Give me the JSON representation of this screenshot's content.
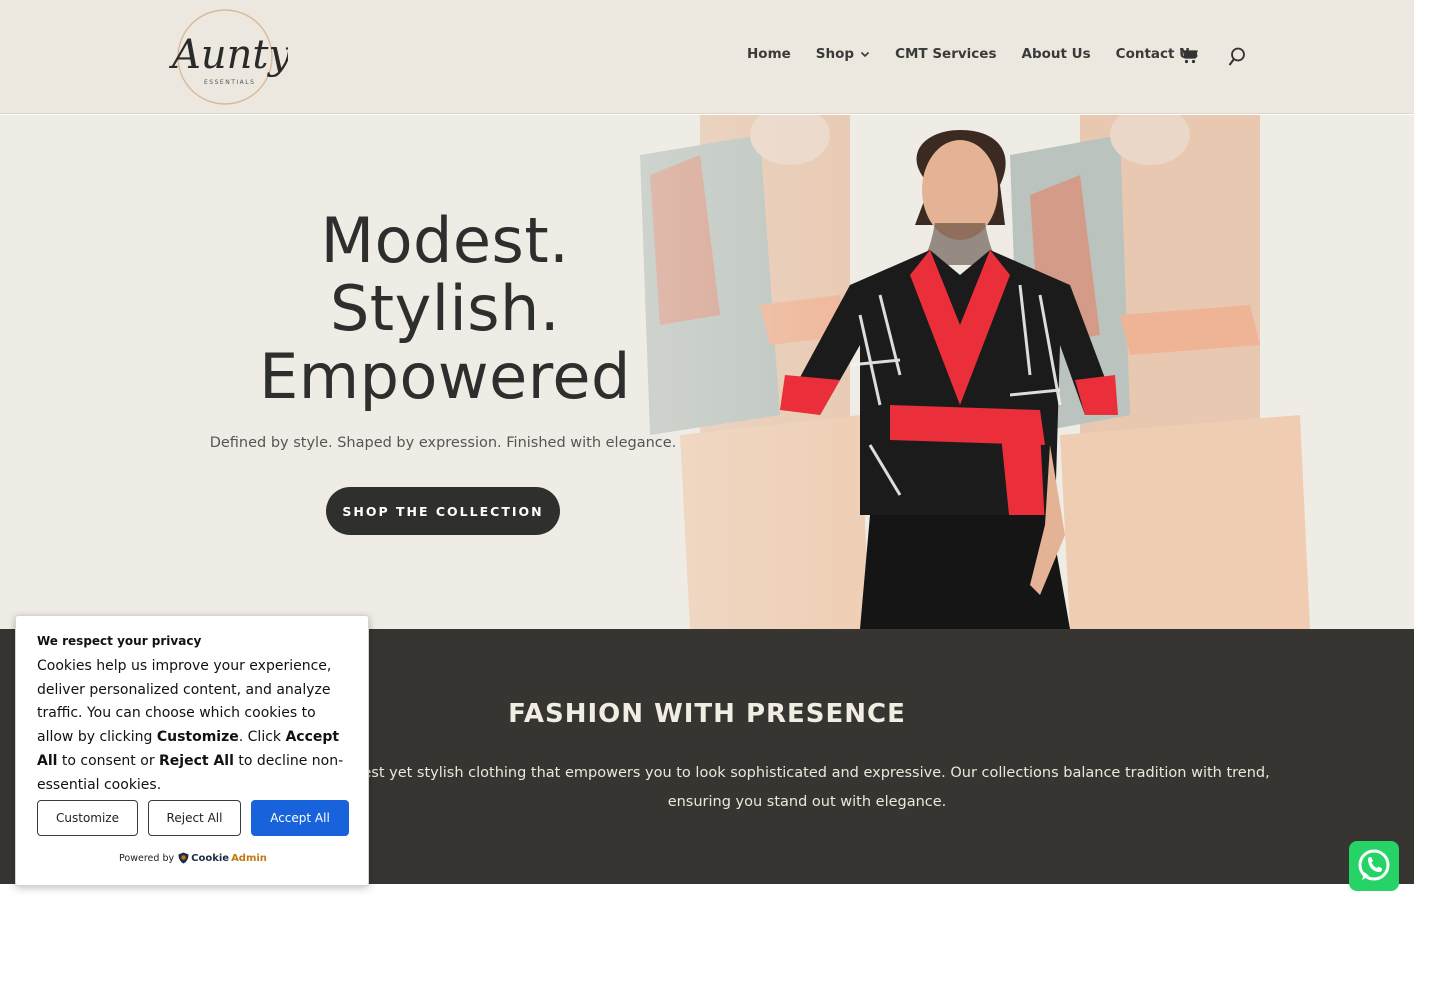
{
  "header": {
    "logo_text": "AuntyK",
    "logo_sub": "ESSENTIALS",
    "nav": [
      {
        "label": "Home"
      },
      {
        "label": "Shop"
      },
      {
        "label": "CMT Services"
      },
      {
        "label": "About Us"
      },
      {
        "label": "Contact Us"
      }
    ],
    "icons": [
      "cart-icon",
      "search-icon"
    ]
  },
  "hero": {
    "title_lines": [
      "Modest.",
      "Stylish.",
      "Empowered"
    ],
    "subtitle": "Defined by style. Shaped by expression. Finished with elegance.",
    "button_label": "SHOP THE COLLECTION"
  },
  "fashion": {
    "title": "FASHION WITH PRESENCE",
    "text": "odest yet stylish clothing that empowers you to look sophisticated and expressive. Our collections balance tradition with trend, ensuring you stand out with elegance."
  },
  "cookie": {
    "title": "We respect your privacy",
    "body_1": "Cookies help us improve your experience, deliver personalized content, and analyze traffic. You can choose which cookies to allow by clicking ",
    "body_customize": "Customize",
    "body_2": ". Click ",
    "body_accept": "Accept All",
    "body_3": " to consent or ",
    "body_reject": "Reject All",
    "body_4": " to decline non-essential cookies.",
    "customize_label": "Customize",
    "reject_label": "Reject All",
    "accept_label": "Accept All",
    "powered_by": "Powered by",
    "brand_cookie": "Cookie",
    "brand_admin": "Admin"
  },
  "colors": {
    "header_bg": "#ece8df",
    "hero_bg": "#efece5",
    "dark_section": "#363532",
    "button_dark": "#2f2f2d",
    "accept_blue": "#1863dc",
    "whatsapp_green": "#25d366"
  }
}
